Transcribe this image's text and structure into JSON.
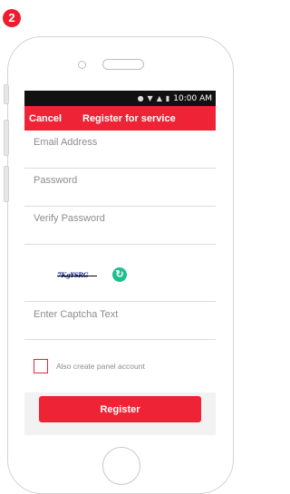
{
  "step": "2",
  "status_bar": {
    "time": "10:00 AM"
  },
  "header": {
    "cancel_label": "Cancel",
    "title": "Register for service"
  },
  "form": {
    "email_placeholder": "Email Address",
    "password_placeholder": "Password",
    "verify_password_placeholder": "Verify Password",
    "captcha_image_text": "7Kg¥SRG",
    "captcha_placeholder": "Enter Captcha Text",
    "panel_account_label": "Also create panel account",
    "panel_account_checked": false
  },
  "footer": {
    "register_label": "Register"
  },
  "colors": {
    "accent": "#ee2436",
    "badge": "#ee1c2e",
    "refresh": "#1fbf8f"
  },
  "icons": [
    "refresh-icon",
    "wifi-icon",
    "signal-icon",
    "battery-icon",
    "vibrate-icon"
  ]
}
